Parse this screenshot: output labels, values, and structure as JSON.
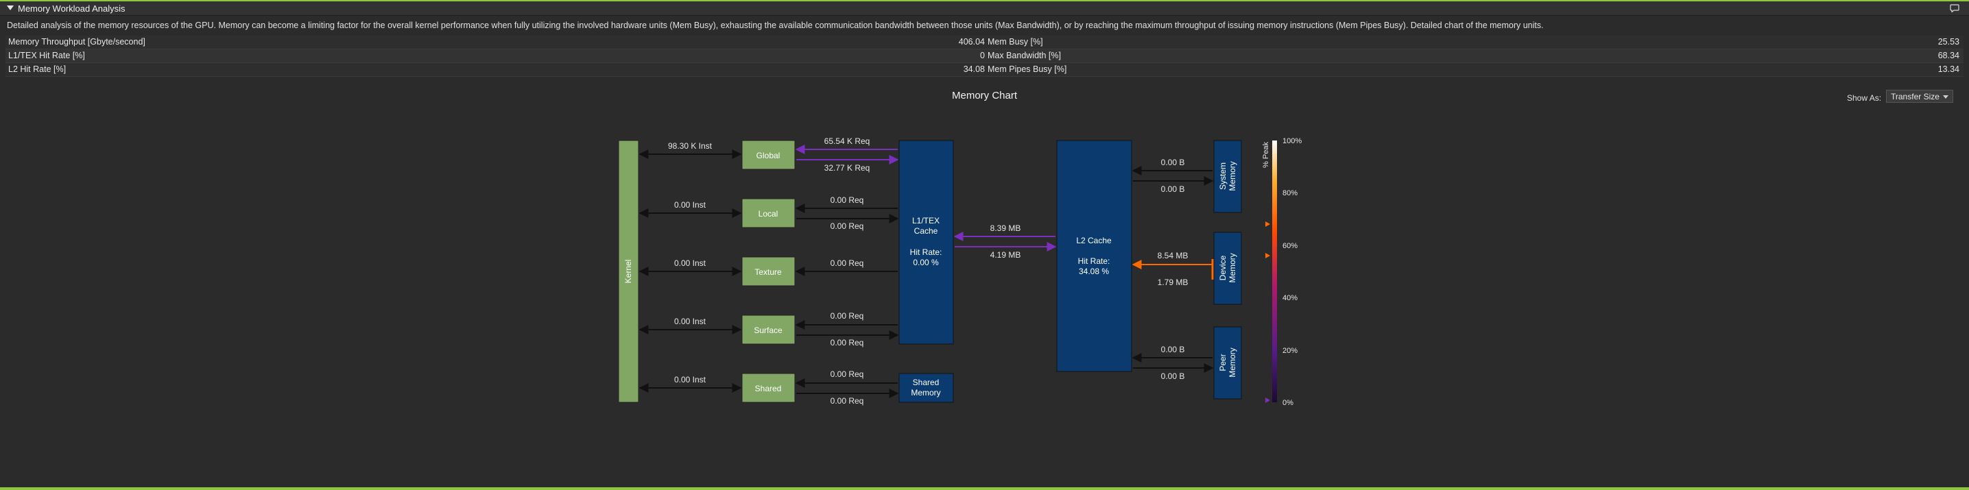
{
  "section": {
    "title": "Memory Workload Analysis",
    "description": "Detailed analysis of the memory resources of the GPU. Memory can become a limiting factor for the overall kernel performance when fully utilizing the involved hardware units (Mem Busy), exhausting the available communication bandwidth between those units (Max Bandwidth), or by reaching the maximum throughput of issuing memory instructions (Mem Pipes Busy). Detailed chart of the memory units."
  },
  "metrics": [
    {
      "label": "Memory Throughput [Gbyte/second]",
      "value": "406.04",
      "label2": "Mem Busy [%]",
      "value2": "25.53"
    },
    {
      "label": "L1/TEX Hit Rate [%]",
      "value": "0",
      "label2": "Max Bandwidth [%]",
      "value2": "68.34"
    },
    {
      "label": "L2 Hit Rate [%]",
      "value": "34.08",
      "label2": "Mem Pipes Busy [%]",
      "value2": "13.34"
    }
  ],
  "chart": {
    "title": "Memory Chart",
    "show_as_label": "Show As:",
    "show_as_value": "Transfer Size",
    "kernel_label": "Kernel",
    "units": [
      {
        "name": "Global",
        "inst": "98.30 K Inst",
        "req_top": "65.54 K Req",
        "req_bottom": "32.77 K Req"
      },
      {
        "name": "Local",
        "inst": "0.00 Inst",
        "req_top": "0.00 Req",
        "req_bottom": "0.00 Req"
      },
      {
        "name": "Texture",
        "inst": "0.00 Inst",
        "req_top": "0.00 Req",
        "req_bottom": ""
      },
      {
        "name": "Surface",
        "inst": "0.00 Inst",
        "req_top": "0.00 Req",
        "req_bottom": "0.00 Req"
      },
      {
        "name": "Shared",
        "inst": "0.00 Inst",
        "req_top": "0.00 Req",
        "req_bottom": "0.00 Req"
      }
    ],
    "l1": {
      "line1": "L1/TEX",
      "line2": "Cache",
      "hit_label": "Hit Rate:",
      "hit_value": "0.00 %"
    },
    "shared_memory": {
      "line1": "Shared",
      "line2": "Memory"
    },
    "l1_l2": {
      "top": "8.39 MB",
      "bottom": "4.19 MB"
    },
    "l2": {
      "line1": "L2 Cache",
      "hit_label": "Hit Rate:",
      "hit_value": "34.08 %"
    },
    "system_memory": {
      "line1": "System",
      "line2": "Memory",
      "top": "0.00 B",
      "bottom": "0.00 B"
    },
    "device_memory": {
      "line1": "Device",
      "line2": "Memory",
      "top": "8.54 MB",
      "bottom": "1.79 MB"
    },
    "peer_memory": {
      "line1": "Peer",
      "line2": "Memory",
      "top": "0.00 B",
      "bottom": "0.00 B"
    },
    "legend": {
      "title": "% Peak",
      "ticks": [
        "100%",
        "80%",
        "60%",
        "40%",
        "20%",
        "0%"
      ]
    }
  },
  "colors": {
    "accent": "#8dc63f",
    "unit_box": "#82a764",
    "cache_box": "#0b3b6e",
    "purple": "#7b2fbe",
    "orange": "#ff6a00"
  }
}
